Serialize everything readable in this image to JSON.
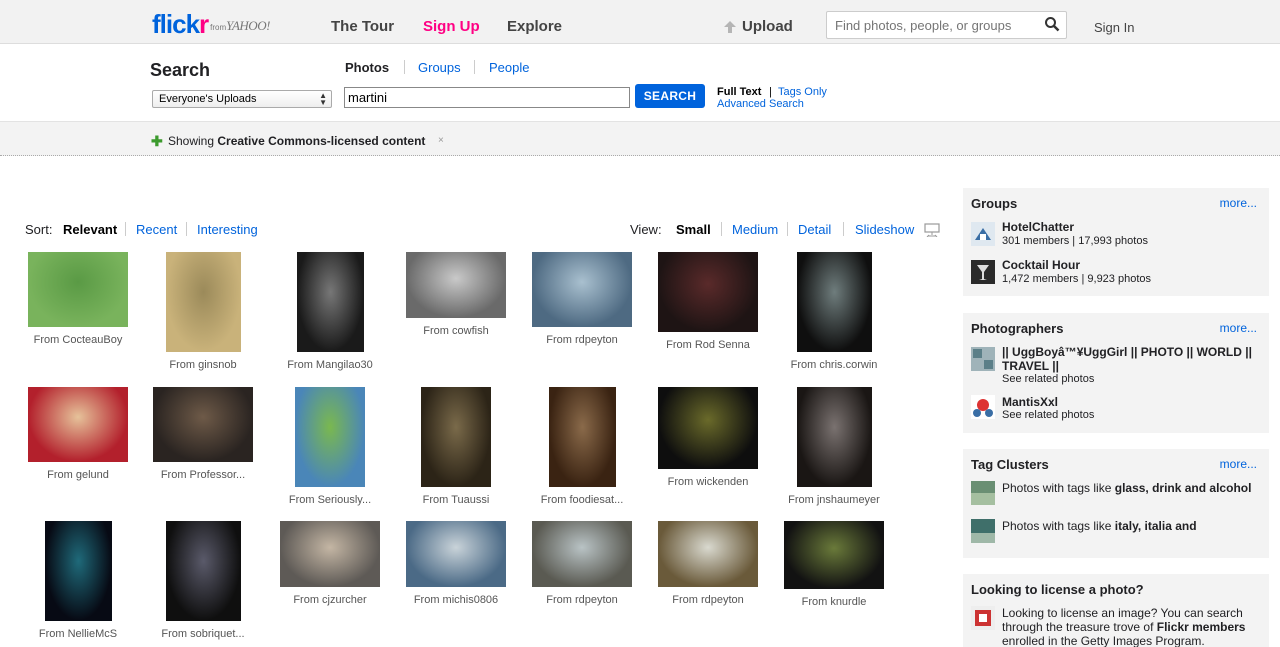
{
  "header": {
    "logo_text_a": "flick",
    "logo_text_b": "r",
    "logo_from": "from",
    "logo_yahoo": "YAHOO!",
    "nav_tour": "The Tour",
    "nav_signup": "Sign Up",
    "nav_explore": "Explore",
    "upload": "Upload",
    "search_placeholder": "Find photos, people, or groups",
    "signin": "Sign In"
  },
  "search": {
    "title": "Search",
    "scope": "Everyone's Uploads",
    "tab_photos": "Photos",
    "tab_groups": "Groups",
    "tab_people": "People",
    "query": "martini",
    "button": "SEARCH",
    "full_text": "Full Text",
    "sep": "|",
    "tags_only": "Tags Only",
    "advanced": "Advanced Search"
  },
  "cc": {
    "prefix": "Showing ",
    "bold": "Creative Commons-licensed content",
    "close": "×"
  },
  "sort": {
    "label": "Sort:",
    "relevant": "Relevant",
    "recent": "Recent",
    "interesting": "Interesting"
  },
  "view": {
    "label": "View:",
    "small": "Small",
    "medium": "Medium",
    "detail": "Detail",
    "slideshow": "Slideshow"
  },
  "photos": [
    {
      "caption": "From CocteauBoy"
    },
    {
      "caption": "From ginsnob"
    },
    {
      "caption": "From Mangilao30"
    },
    {
      "caption": "From cowfish"
    },
    {
      "caption": "From rdpeyton"
    },
    {
      "caption": "From Rod Senna"
    },
    {
      "caption": "From chris.corwin"
    },
    {
      "caption": "From gelund"
    },
    {
      "caption": "From Professor..."
    },
    {
      "caption": "From Seriously..."
    },
    {
      "caption": "From Tuaussi"
    },
    {
      "caption": "From foodiesat..."
    },
    {
      "caption": "From wickenden"
    },
    {
      "caption": "From jnshaumeyer"
    },
    {
      "caption": "From NellieMcS"
    },
    {
      "caption": "From sobriquet..."
    },
    {
      "caption": "From cjzurcher"
    },
    {
      "caption": "From michis0806"
    },
    {
      "caption": "From rdpeyton"
    },
    {
      "caption": "From rdpeyton"
    },
    {
      "caption": "From knurdle"
    }
  ],
  "sidebar": {
    "groups": {
      "title": "Groups",
      "more": "more...",
      "items": [
        {
          "name": "HotelChatter",
          "sub": "301 members | 17,993 photos"
        },
        {
          "name": "Cocktail Hour",
          "sub": "1,472 members | 9,923 photos"
        }
      ]
    },
    "photographers": {
      "title": "Photographers",
      "more": "more...",
      "items": [
        {
          "name_line1": "|| UggBoyâ™¥UggGirl || PHOTO || WORLD ||",
          "name_line2": "TRAVEL ||",
          "sub": "See related photos"
        },
        {
          "name_line1": "MantisXxl",
          "sub": "See related photos"
        }
      ]
    },
    "tag_clusters": {
      "title": "Tag Clusters",
      "more": "more...",
      "items": [
        {
          "prefix": "Photos with tags like ",
          "tags": "glass, drink and alcohol"
        },
        {
          "prefix": "Photos with tags like ",
          "tags": "italy, italia and"
        }
      ]
    },
    "license": {
      "title": "Looking to license a photo?",
      "line1": "Looking to license an image? You can search",
      "line2_prefix": "through the treasure trove of ",
      "line2_bold": "Flickr members",
      "line3": "enrolled in the Getty Images Program."
    }
  }
}
